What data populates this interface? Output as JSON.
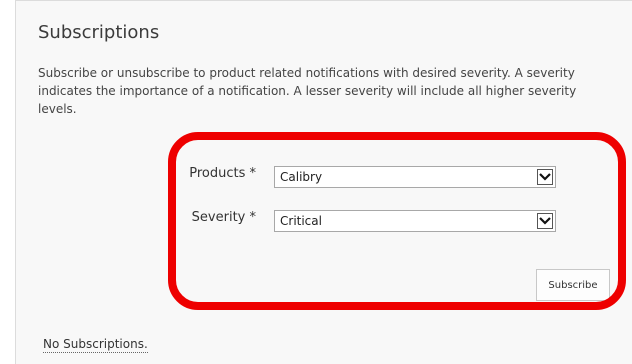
{
  "header": {
    "title": "Subscriptions"
  },
  "description": "Subscribe or unsubscribe to product related notifications with desired severity. A severity indicates the importance of a notification. A lesser severity will include all higher severity levels.",
  "form": {
    "products": {
      "label": "Products *",
      "value": "Calibry"
    },
    "severity": {
      "label": "Severity *",
      "value": "Critical"
    },
    "subscribe_label": "Subscribe"
  },
  "subscriptions": {
    "empty_text": "No Subscriptions."
  },
  "colors": {
    "highlight": "#ee0000",
    "panel_bg": "#f8f8f8"
  }
}
